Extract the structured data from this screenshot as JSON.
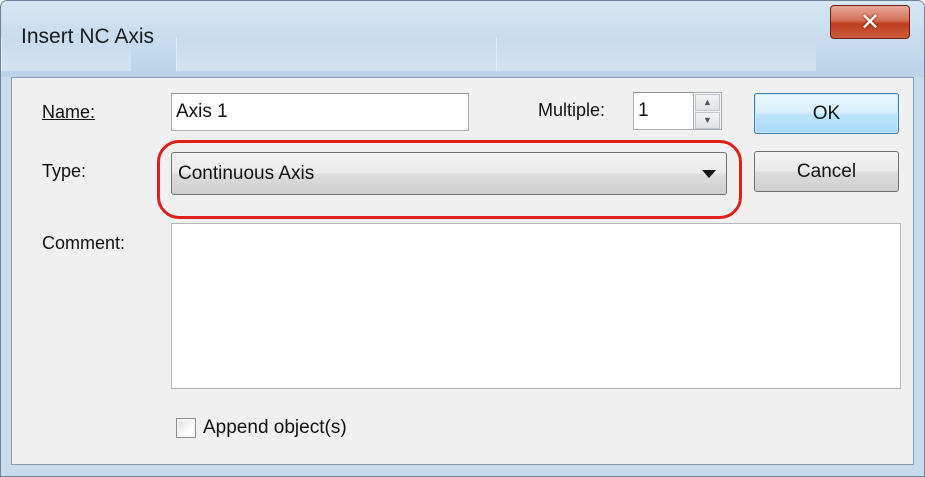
{
  "dialog": {
    "title": "Insert NC Axis",
    "close_glyph": "✕"
  },
  "fields": {
    "name_label": "Name:",
    "name_value": "Axis 1",
    "multiple_label": "Multiple:",
    "multiple_value": "1",
    "type_label": "Type:",
    "type_value": "Continuous Axis",
    "comment_label": "Comment:",
    "comment_value": ""
  },
  "buttons": {
    "ok": "OK",
    "cancel": "Cancel"
  },
  "options": {
    "append_label": "Append object(s)",
    "append_checked": false
  },
  "icons": {
    "close": "close-icon",
    "spin_up": "spin-up-icon",
    "spin_down": "spin-down-icon",
    "dropdown": "chevron-down-icon"
  },
  "colors": {
    "highlight": "#e0211b",
    "default_button": "#bee6fd",
    "close_button": "#c03d21"
  }
}
